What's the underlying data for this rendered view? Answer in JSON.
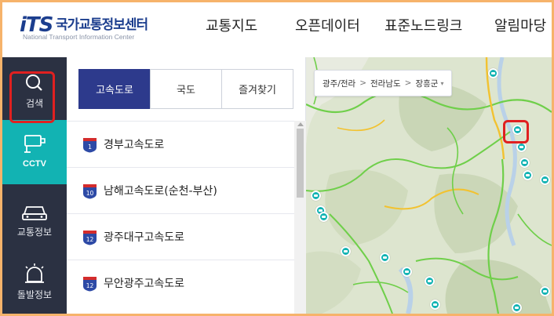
{
  "header": {
    "logo_mark": "iTS",
    "logo_kr": "국가교통정보센터",
    "logo_en": "National Transport Information Center",
    "nav": [
      {
        "label": "교통지도"
      },
      {
        "label": "오픈데이터"
      },
      {
        "label": "표준노드링크"
      },
      {
        "label": "알림마당"
      }
    ]
  },
  "sidebar": {
    "items": [
      {
        "label": "검색",
        "icon": "search-icon",
        "active": false
      },
      {
        "label": "CCTV",
        "icon": "cctv-icon",
        "active": true
      },
      {
        "label": "교통정보",
        "icon": "car-icon",
        "active": false
      },
      {
        "label": "돌발정보",
        "icon": "alert-siren-icon",
        "active": false
      }
    ]
  },
  "panel": {
    "tabs": [
      {
        "label": "고속도로",
        "active": true
      },
      {
        "label": "국도",
        "active": false
      },
      {
        "label": "즐겨찾기",
        "active": false
      }
    ],
    "roads": [
      {
        "number": "1",
        "name": "경부고속도로"
      },
      {
        "number": "10",
        "name": "남해고속도로(순천-부산)"
      },
      {
        "number": "12",
        "name": "광주대구고속도로"
      },
      {
        "number": "12",
        "name": "무안광주고속도로"
      }
    ]
  },
  "map": {
    "breadcrumb": [
      "광주/전라",
      "전라남도",
      "장흥군"
    ],
    "colors": {
      "cctv": "#12b3b3",
      "road_free": "#6fcf4a",
      "road_slow": "#f2c230",
      "highlight": "#e02020"
    }
  }
}
